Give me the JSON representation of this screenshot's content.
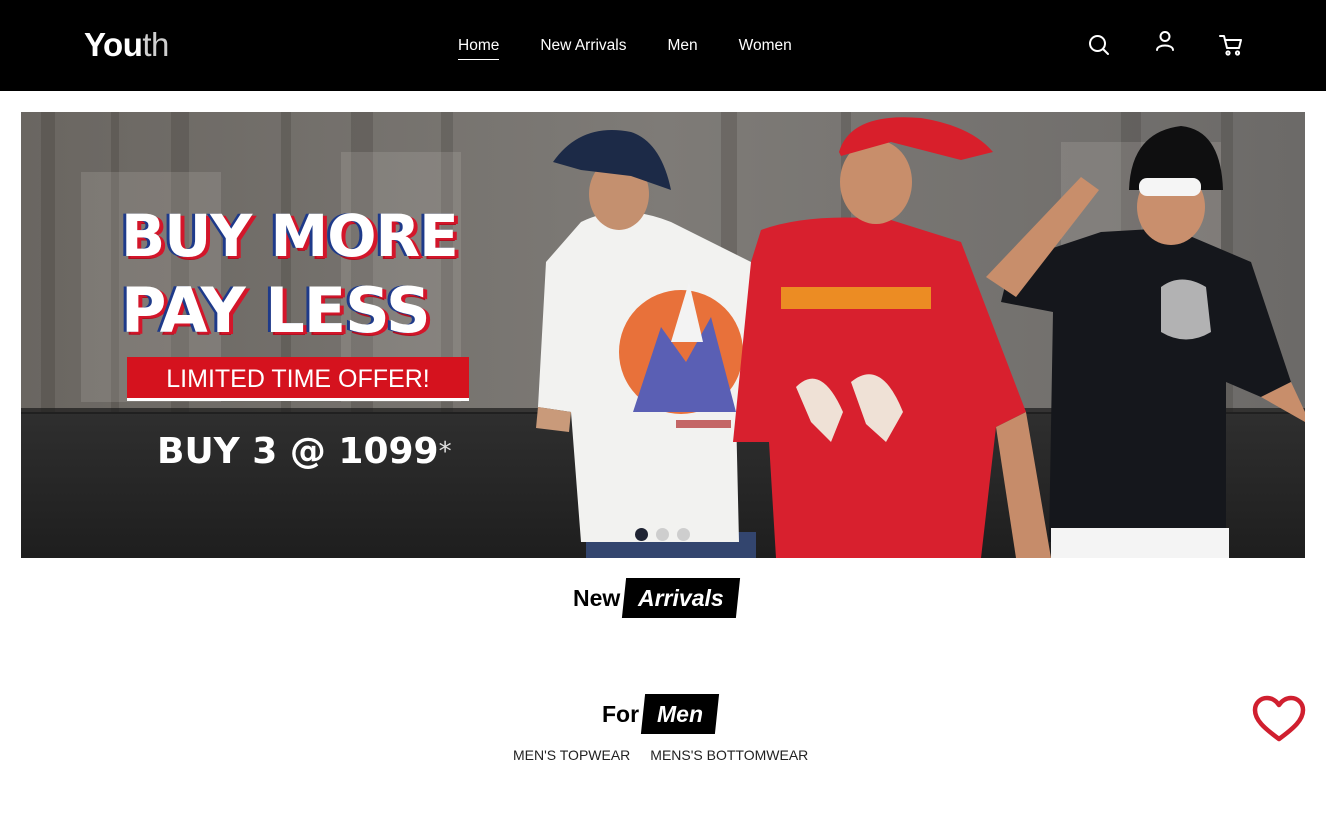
{
  "header": {
    "logo_bold": "You",
    "logo_light": "th",
    "nav": [
      {
        "label": "Home",
        "active": true
      },
      {
        "label": "New Arrivals",
        "active": false
      },
      {
        "label": "Men",
        "active": false
      },
      {
        "label": "Women",
        "active": false
      }
    ],
    "icons": [
      "search-icon",
      "user-icon",
      "cart-icon"
    ]
  },
  "hero": {
    "line1": "BUY MORE",
    "line2": "PAY LESS",
    "offer": "LIMITED TIME OFFER!",
    "deal": "BUY 3 @ 1099",
    "deal_mark": "*",
    "slides": 3,
    "active_slide": 1,
    "colors": {
      "offer_red": "#d5121e",
      "tee_red": "#d8202e",
      "tee_white": "#f2f2f0",
      "tee_black": "#15171c"
    }
  },
  "new_arrivals": {
    "plain": "New",
    "boxed": "Arrivals"
  },
  "for_men": {
    "plain": "For",
    "boxed": "Men",
    "categories": [
      "MEN'S TOPWEAR",
      "MENS'S BOTTOMWEAR"
    ]
  },
  "wishlist": {
    "icon": "heart-icon",
    "color": "#d01f2f"
  }
}
